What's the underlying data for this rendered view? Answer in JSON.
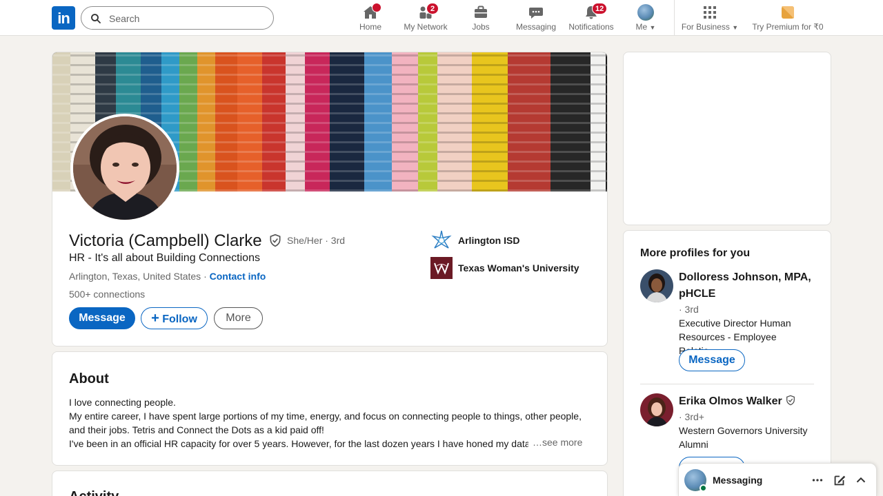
{
  "nav": {
    "search_placeholder": "Search",
    "items": [
      {
        "label": "Home",
        "icon": "home-icon",
        "badge": ""
      },
      {
        "label": "My Network",
        "icon": "network-icon",
        "badge": "2"
      },
      {
        "label": "Jobs",
        "icon": "jobs-icon",
        "badge": ""
      },
      {
        "label": "Messaging",
        "icon": "messaging-icon",
        "badge": ""
      },
      {
        "label": "Notifications",
        "icon": "bell-icon",
        "badge": "12"
      },
      {
        "label": "Me",
        "icon": "avatar",
        "badge": ""
      },
      {
        "label": "For Business",
        "icon": "grid-icon",
        "badge": ""
      },
      {
        "label": "Try Premium for ₹0",
        "icon": "premium-icon",
        "badge": ""
      }
    ]
  },
  "profile": {
    "name": "Victoria (Campbell) Clarke",
    "pronouns": "She/Her · 3rd",
    "headline": "HR - It's all about Building Connections",
    "location": "Arlington, Texas, United States · ",
    "contact_info": "Contact info",
    "connections": "500+ connections",
    "buttons": {
      "message": "Message",
      "follow": "Follow",
      "more": "More"
    },
    "orgs": [
      {
        "name": "Arlington ISD"
      },
      {
        "name": "Texas Woman's University"
      }
    ]
  },
  "about": {
    "title": "About",
    "lines": [
      "I love connecting people.",
      "My entire career, I have spent large portions of my time, energy, and focus on connecting people to things, other people,",
      "and their jobs. Tetris and Connect the Dots as a kid paid off!",
      "I've been in an official HR capacity for over 5 years. However, for the last dozen years I have honed my data tra"
    ],
    "see_more": "…see more"
  },
  "activity": {
    "title": "Activity"
  },
  "more_profiles": {
    "title": "More profiles for you",
    "people": [
      {
        "name": "Dolloress Johnson, MPA, pHCLE",
        "degree": "· 3rd",
        "description": "Executive Director Human Resources - Employee Relatio…",
        "button": "Message"
      },
      {
        "name": "Erika Olmos Walker",
        "degree": "· 3rd+",
        "description": "Western Governors University Alumni",
        "button": ""
      }
    ]
  },
  "messaging": {
    "label": "Messaging"
  },
  "colors": {
    "brand": "#0a66c2",
    "badge": "#cb112d",
    "background": "#f4f2ee"
  }
}
